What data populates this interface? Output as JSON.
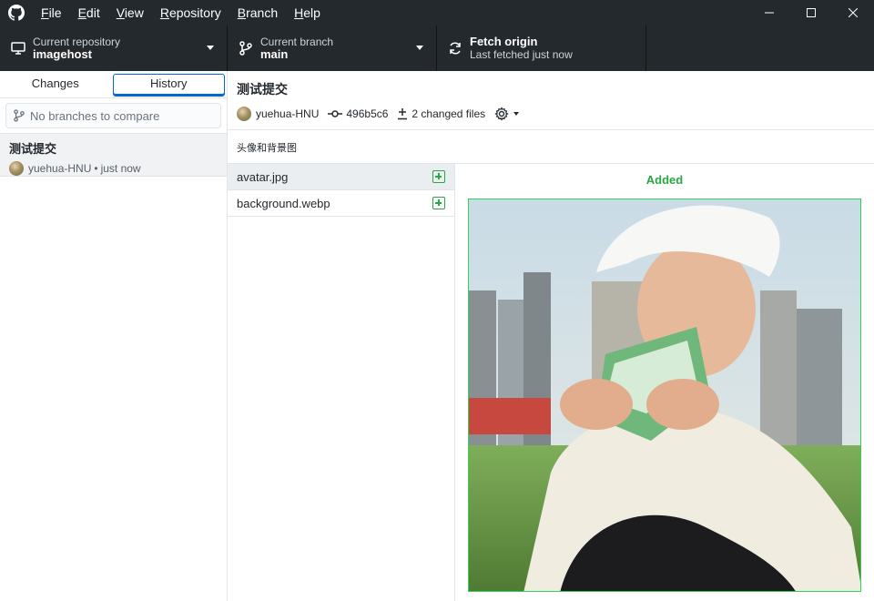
{
  "menu": {
    "file": {
      "ul": "F",
      "rest": "ile"
    },
    "edit": {
      "ul": "E",
      "rest": "dit"
    },
    "view": {
      "ul": "V",
      "rest": "iew"
    },
    "repository": {
      "ul": "R",
      "rest": "epository"
    },
    "branch": {
      "ul": "B",
      "rest": "ranch"
    },
    "help": {
      "ul": "H",
      "rest": "elp"
    }
  },
  "toolbar": {
    "repo_label": "Current repository",
    "repo_value": "imagehost",
    "branch_label": "Current branch",
    "branch_value": "main",
    "fetch_label": "Fetch origin",
    "fetch_sub": "Last fetched just now"
  },
  "sidebar": {
    "tabs": [
      "Changes",
      "History"
    ],
    "selected_tab": "History",
    "compare_placeholder": "No branches to compare",
    "commit": {
      "title": "测试提交",
      "author": "yuehua-HNU",
      "time": "just now",
      "separator": "•"
    }
  },
  "commit_detail": {
    "title": "测试提交",
    "author": "yuehua-HNU",
    "sha": "496b5c6",
    "changed_files": "2 changed files",
    "description": "头像和背景图"
  },
  "files": [
    {
      "name": "avatar.jpg",
      "status": "added",
      "selected": true
    },
    {
      "name": "background.webp",
      "status": "added",
      "selected": false
    }
  ],
  "diff": {
    "label": "Added"
  },
  "colors": {
    "dark_bar": "#24292e",
    "accent_blue": "#0366d6",
    "added_green": "#28a745"
  }
}
